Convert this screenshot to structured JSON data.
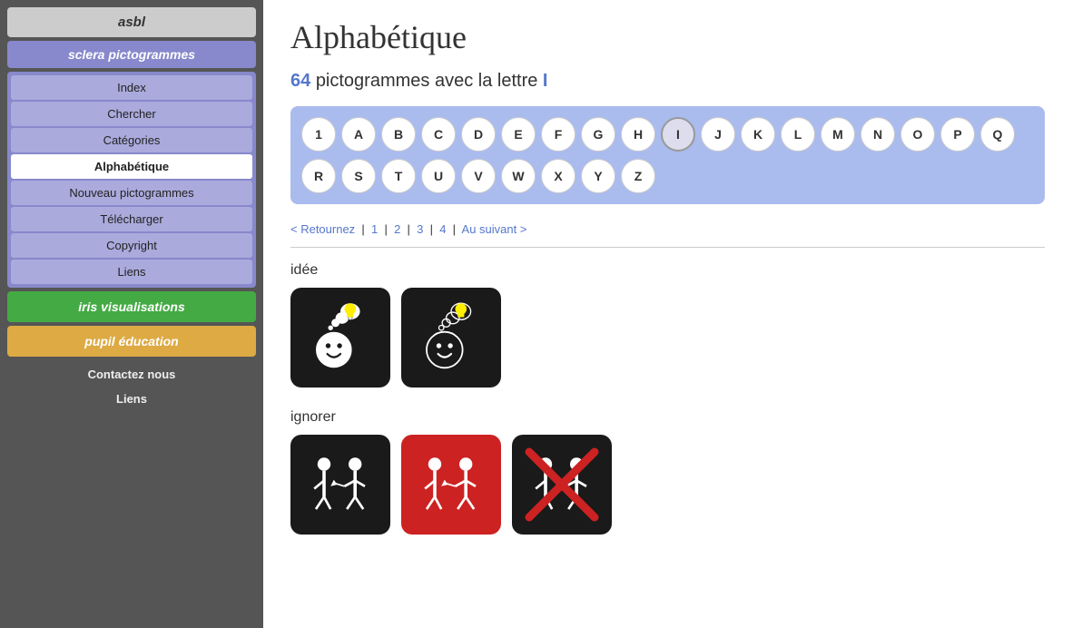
{
  "sidebar": {
    "asbl_label": "asbl",
    "section_label": "sclera pictogrammes",
    "nav_items": [
      {
        "label": "Index",
        "active": false,
        "id": "index"
      },
      {
        "label": "Chercher",
        "active": false,
        "id": "chercher"
      },
      {
        "label": "Catégories",
        "active": false,
        "id": "categories"
      },
      {
        "label": "Alphabétique",
        "active": true,
        "id": "alphabetique"
      },
      {
        "label": "Nouveau pictogrammes",
        "active": false,
        "id": "nouveau"
      },
      {
        "label": "Télécharger",
        "active": false,
        "id": "telecharger"
      },
      {
        "label": "Copyright",
        "active": false,
        "id": "copyright"
      },
      {
        "label": "Liens",
        "active": false,
        "id": "liens"
      }
    ],
    "iris_label": "iris visualisations",
    "pupil_label": "pupil éducation",
    "bottom_links": [
      {
        "label": "Contactez nous",
        "id": "contact"
      },
      {
        "label": "Liens",
        "id": "liens-bottom"
      }
    ]
  },
  "main": {
    "page_title": "Alphabétique",
    "count": "64",
    "count_text": "pictogrammes avec la lettre",
    "active_letter": "I",
    "alphabet_row1": [
      "1",
      "A",
      "B",
      "C",
      "D",
      "E",
      "F",
      "G",
      "H",
      "I",
      "J",
      "K",
      "L",
      "M",
      "N",
      "O",
      "P",
      "Q"
    ],
    "alphabet_row2": [
      "R",
      "S",
      "T",
      "U",
      "V",
      "W",
      "X",
      "Y",
      "Z"
    ],
    "pagination": {
      "back": "< Retournez",
      "pages": [
        "1",
        "2",
        "3",
        "4"
      ],
      "forward": "Au suivant >"
    },
    "sections": [
      {
        "word": "idée",
        "pictograms": [
          {
            "style": "black",
            "type": "idea-happy"
          },
          {
            "style": "black",
            "type": "idea-dark"
          }
        ]
      },
      {
        "word": "ignorer",
        "pictograms": [
          {
            "style": "black",
            "type": "ignore-neutral"
          },
          {
            "style": "red",
            "type": "ignore-red"
          },
          {
            "style": "black-cross",
            "type": "ignore-cross"
          }
        ]
      }
    ]
  }
}
